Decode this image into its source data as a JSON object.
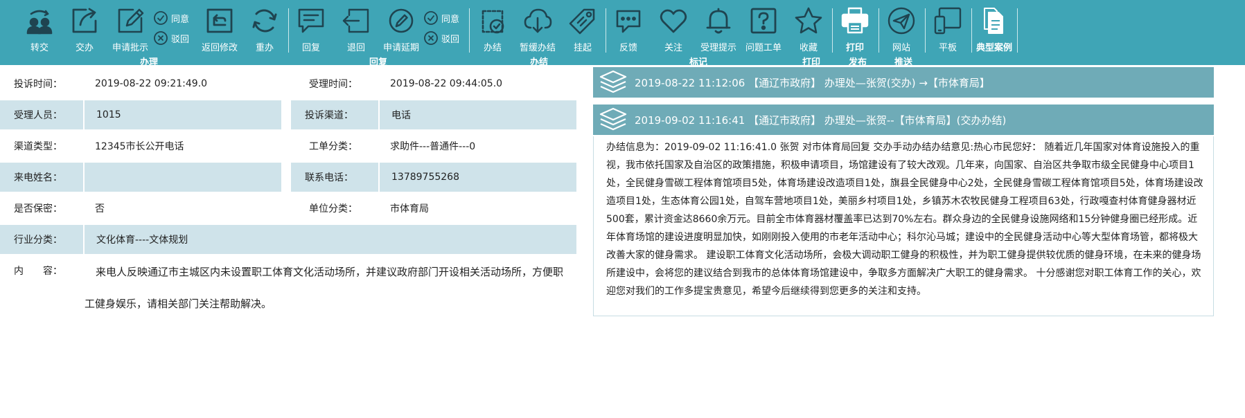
{
  "toolbar": {
    "items": [
      {
        "label": "转交",
        "icon": "transfer-users-icon"
      },
      {
        "label": "交办",
        "icon": "share-export-icon"
      },
      {
        "label": "申请批示",
        "icon": "edit-pencil-icon"
      },
      {
        "label": "返回修改",
        "icon": "return-edit-icon"
      },
      {
        "label": "重办",
        "icon": "redo-refresh-icon"
      },
      {
        "label": "回复",
        "icon": "reply-message-icon"
      },
      {
        "label": "退回",
        "icon": "send-back-icon"
      },
      {
        "label": "申请延期",
        "icon": "extension-edit-icon"
      },
      {
        "label": "办结",
        "icon": "clipboard-check-icon"
      },
      {
        "label": "暂缓办结",
        "icon": "cloud-download-icon"
      },
      {
        "label": "挂起",
        "icon": "tag-icon"
      },
      {
        "label": "反馈",
        "icon": "feedback-chat-icon"
      },
      {
        "label": "关注",
        "icon": "heart-icon"
      },
      {
        "label": "受理提示",
        "icon": "bell-icon"
      },
      {
        "label": "问题工单",
        "icon": "question-icon"
      },
      {
        "label": "收藏",
        "icon": "star-icon"
      },
      {
        "label": "打印",
        "icon": "printer-icon"
      },
      {
        "label": "网站",
        "icon": "paper-plane-icon"
      },
      {
        "label": "平板",
        "icon": "tablet-phone-icon"
      },
      {
        "label": "典型案例",
        "icon": "copy-documents-icon"
      }
    ],
    "approve_1": "同意",
    "reject_1": "驳回",
    "approve_2": "同意",
    "reject_2": "驳回",
    "groups": {
      "handle": "办理",
      "reply": "回复",
      "finish": "办结",
      "mark": "标记",
      "print": "打印",
      "publish": "发布",
      "push": "推送"
    }
  },
  "info": {
    "complaint_time_label": "投诉时间：",
    "complaint_time": "2019-08-22 09:21:49.0",
    "accept_time_label": "受理时间：",
    "accept_time": "2019-08-22 09:44:05.0",
    "handler_label": "受理人员：",
    "handler": "1015",
    "channel_label": "投诉渠道：",
    "channel": "电话",
    "channel_type_label": "渠道类型：",
    "channel_type": "12345市长公开电话",
    "order_category_label": "工单分类：",
    "order_category": "求助件---普通件---0",
    "caller_name_label": "来电姓名：",
    "caller_name": "",
    "phone_label": "联系电话：",
    "phone": "13789755268",
    "confidential_label": "是否保密：",
    "confidential": "否",
    "unit_category_label": "单位分类：",
    "unit_category": "市体育局",
    "industry_label": "行业分类：",
    "industry": "文化体育----文体规划",
    "content_label": "内　　容：",
    "content": "来电人反映通辽市主城区内未设置职工体育文化活动场所，并建议政府部门开设相关活动场所，方便职工健身娱乐，请相关部门关注帮助解决。"
  },
  "flow": {
    "entries": [
      "2019-08-22 11:12:06 【通辽市政府】 办理处—张贺(交办) →【市体育局】",
      "2019-09-02 11:16:41 【通辽市政府】 办理处—张贺--【市体育局】(交办办结)"
    ],
    "detail": "办结信息为：2019-09-02 11:16:41.0 张贺 对市体育局回复  交办手动办结办结意见:热心市民您好： 随着近几年国家对体育设施投入的重视，我市依托国家及自治区的政策措施，积极申请项目，场馆建设有了较大改观。几年来，向国家、自治区共争取市级全民健身中心项目1处，全民健身雪碳工程体育馆项目5处，体育场建设改造项目1处，旗县全民健身中心2处，全民健身雪碳工程体育馆项目5处，体育场建设改造项目1处，生态体育公园1处，自驾车营地项目1处，美丽乡村项目1处，乡镇苏木农牧民健身工程项目63处，行政嘎查村体育健身器材近500套，累计资金达8660余万元。目前全市体育器材覆盖率已达到70%左右。群众身边的全民健身设施网络和15分钟健身圈已经形成。近年体育场馆的建设进度明显加快，如刚刚投入使用的市老年活动中心；科尔沁马城；建设中的全民健身活动中心等大型体育场管，都将极大改善大家的健身需求。 建设职工体育文化活动场所，会极大调动职工健身的积极性，并为职工健身提供较优质的健身环境，在未来的健身场所建设中，会将您的建议结合到我市的总体体育场馆建设中，争取多方面解决广大职工的健身需求。 十分感谢您对职工体育工作的关心，欢迎您对我们的工作多提宝贵意见，希望今后继续得到您更多的关注和支持。"
  },
  "colors": {
    "toolbar_bg": "#3fa5b6",
    "flow_header_bg": "#6fabb7",
    "row_shade": "#cfe3ea"
  }
}
